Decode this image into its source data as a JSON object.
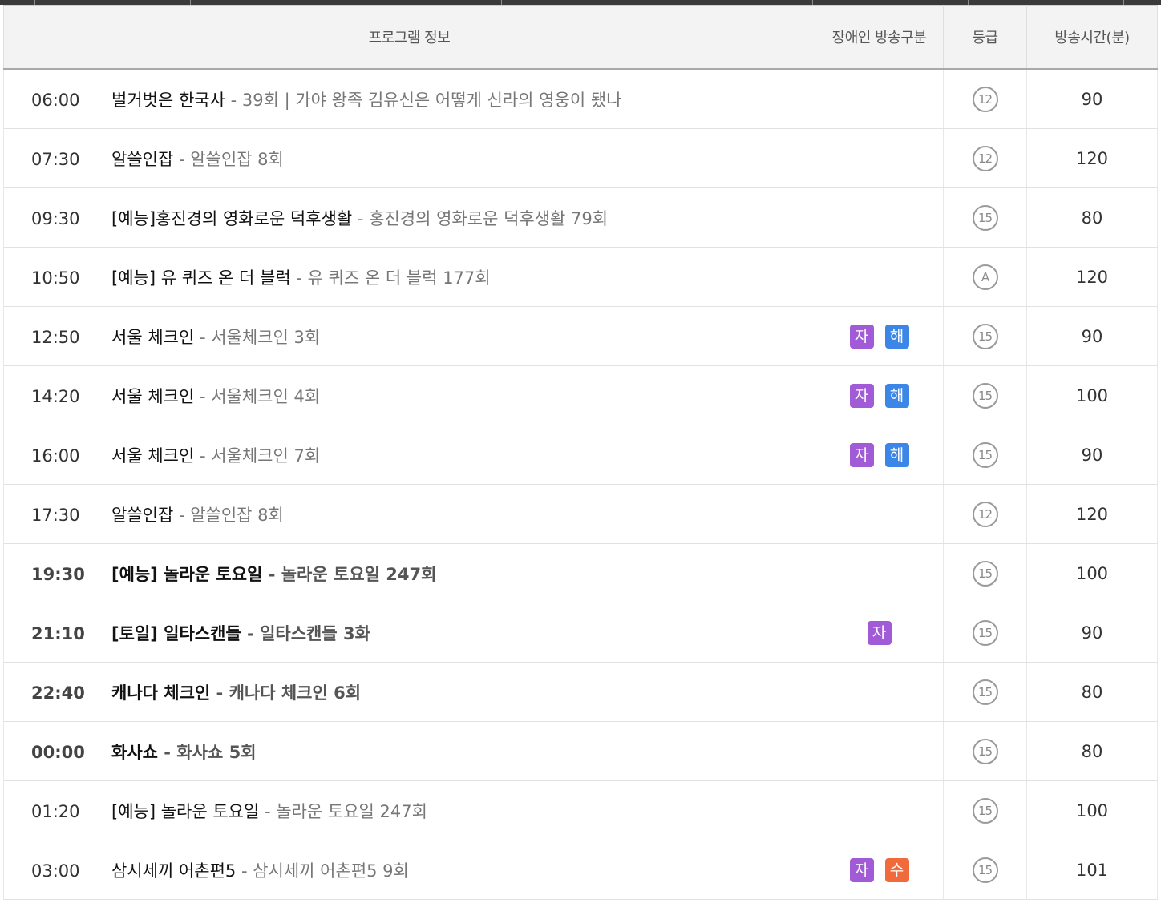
{
  "colors": {
    "badge_ja": "#a15bd6",
    "badge_hae": "#3b86e6",
    "badge_su": "#f06a3c"
  },
  "header": {
    "program_info": "프로그램 정보",
    "accessibility": "장애인 방송구분",
    "grade": "등급",
    "duration": "방송시간(분)"
  },
  "rows": [
    {
      "time": "06:00",
      "title": "벌거벗은 한국사",
      "sep": " - ",
      "episode": "39회 | 가야 왕족 김유신은 어떻게 신라의 영웅이 됐나",
      "badges": [],
      "grade": "12",
      "duration": "90",
      "bold": false
    },
    {
      "time": "07:30",
      "title": "알쓸인잡",
      "sep": " - ",
      "episode": "알쓸인잡 8회",
      "badges": [],
      "grade": "12",
      "duration": "120",
      "bold": false
    },
    {
      "time": "09:30",
      "title": "[예능]홍진경의 영화로운 덕후생활",
      "sep": " - ",
      "episode": "홍진경의 영화로운 덕후생활 79회",
      "badges": [],
      "grade": "15",
      "duration": "80",
      "bold": false
    },
    {
      "time": "10:50",
      "title": "[예능] 유 퀴즈 온 더 블럭",
      "sep": " - ",
      "episode": "유 퀴즈 온 더 블럭 177회",
      "badges": [],
      "grade": "A",
      "duration": "120",
      "bold": false
    },
    {
      "time": "12:50",
      "title": "서울 체크인",
      "sep": " - ",
      "episode": "서울체크인 3회",
      "badges": [
        {
          "label": "자",
          "kind": "ja"
        },
        {
          "label": "해",
          "kind": "hae"
        }
      ],
      "grade": "15",
      "duration": "90",
      "bold": false
    },
    {
      "time": "14:20",
      "title": "서울 체크인",
      "sep": " - ",
      "episode": "서울체크인 4회",
      "badges": [
        {
          "label": "자",
          "kind": "ja"
        },
        {
          "label": "해",
          "kind": "hae"
        }
      ],
      "grade": "15",
      "duration": "100",
      "bold": false
    },
    {
      "time": "16:00",
      "title": "서울 체크인",
      "sep": " - ",
      "episode": "서울체크인 7회",
      "badges": [
        {
          "label": "자",
          "kind": "ja"
        },
        {
          "label": "해",
          "kind": "hae"
        }
      ],
      "grade": "15",
      "duration": "90",
      "bold": false
    },
    {
      "time": "17:30",
      "title": "알쓸인잡",
      "sep": " - ",
      "episode": "알쓸인잡 8회",
      "badges": [],
      "grade": "12",
      "duration": "120",
      "bold": false
    },
    {
      "time": "19:30",
      "title": "[예능] 놀라운 토요일",
      "sep": " - ",
      "episode": "놀라운 토요일 247회",
      "badges": [],
      "grade": "15",
      "duration": "100",
      "bold": true
    },
    {
      "time": "21:10",
      "title": "[토일] 일타스캔들",
      "sep": " - ",
      "episode": "일타스캔들 3화",
      "badges": [
        {
          "label": "자",
          "kind": "ja"
        }
      ],
      "grade": "15",
      "duration": "90",
      "bold": true
    },
    {
      "time": "22:40",
      "title": "캐나다 체크인",
      "sep": " - ",
      "episode": "캐나다 체크인 6회",
      "badges": [],
      "grade": "15",
      "duration": "80",
      "bold": true
    },
    {
      "time": "00:00",
      "title": "화사쇼",
      "sep": " - ",
      "episode": "화사쇼 5회",
      "badges": [],
      "grade": "15",
      "duration": "80",
      "bold": true
    },
    {
      "time": "01:20",
      "title": "[예능] 놀라운 토요일",
      "sep": " - ",
      "episode": "놀라운 토요일 247회",
      "badges": [],
      "grade": "15",
      "duration": "100",
      "bold": false
    },
    {
      "time": "03:00",
      "title": "삼시세끼 어촌편5",
      "sep": " - ",
      "episode": "삼시세끼 어촌편5 9회",
      "badges": [
        {
          "label": "자",
          "kind": "ja"
        },
        {
          "label": "수",
          "kind": "su"
        }
      ],
      "grade": "15",
      "duration": "101",
      "bold": false
    }
  ]
}
